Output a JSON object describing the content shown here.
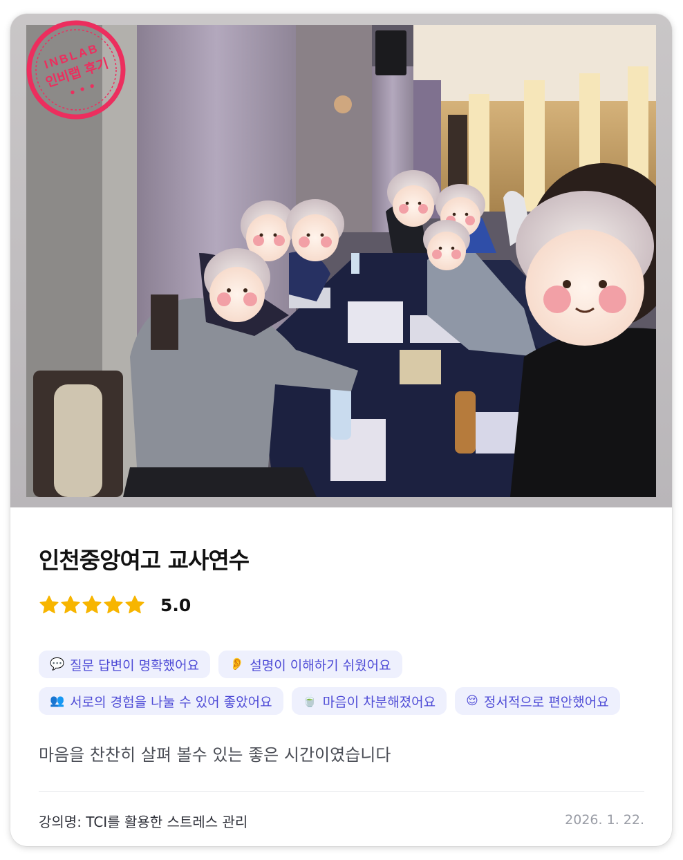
{
  "stamp": {
    "brand": "INBLAB",
    "label": "인비랩 후기",
    "dots": "• • •",
    "color": "#ec2e5e"
  },
  "photo": {
    "icon": "group-photo-with-cartoon-face-stickers"
  },
  "review": {
    "title": "인천중앙여고 교사연수",
    "rating": {
      "value": "5.0",
      "stars_filled": 5,
      "stars_total": 5,
      "star_color": "#f7b500"
    },
    "tags": [
      [
        {
          "emoji": "💬",
          "text": "질문 답변이 명확했어요"
        },
        {
          "emoji": "👂",
          "text": "설명이 이해하기 쉬웠어요"
        }
      ],
      [
        {
          "emoji": "👥",
          "text": "서로의 경험을 나눌 수 있어 좋았어요"
        },
        {
          "emoji": "🍵",
          "text": "마음이 차분해졌어요"
        },
        {
          "emoji": "😌",
          "text": "정서적으로 편안했어요"
        }
      ]
    ],
    "text": "마음을 찬찬히 살펴 볼수 있는 좋은 시간이였습니다",
    "course_label": "강의명: TCI를 활용한 스트레스 관리",
    "date": "2026. 1. 22."
  },
  "colors": {
    "tag_bg": "#eef0fd",
    "tag_text": "#4e4bd6",
    "stamp": "#ec2e5e"
  }
}
